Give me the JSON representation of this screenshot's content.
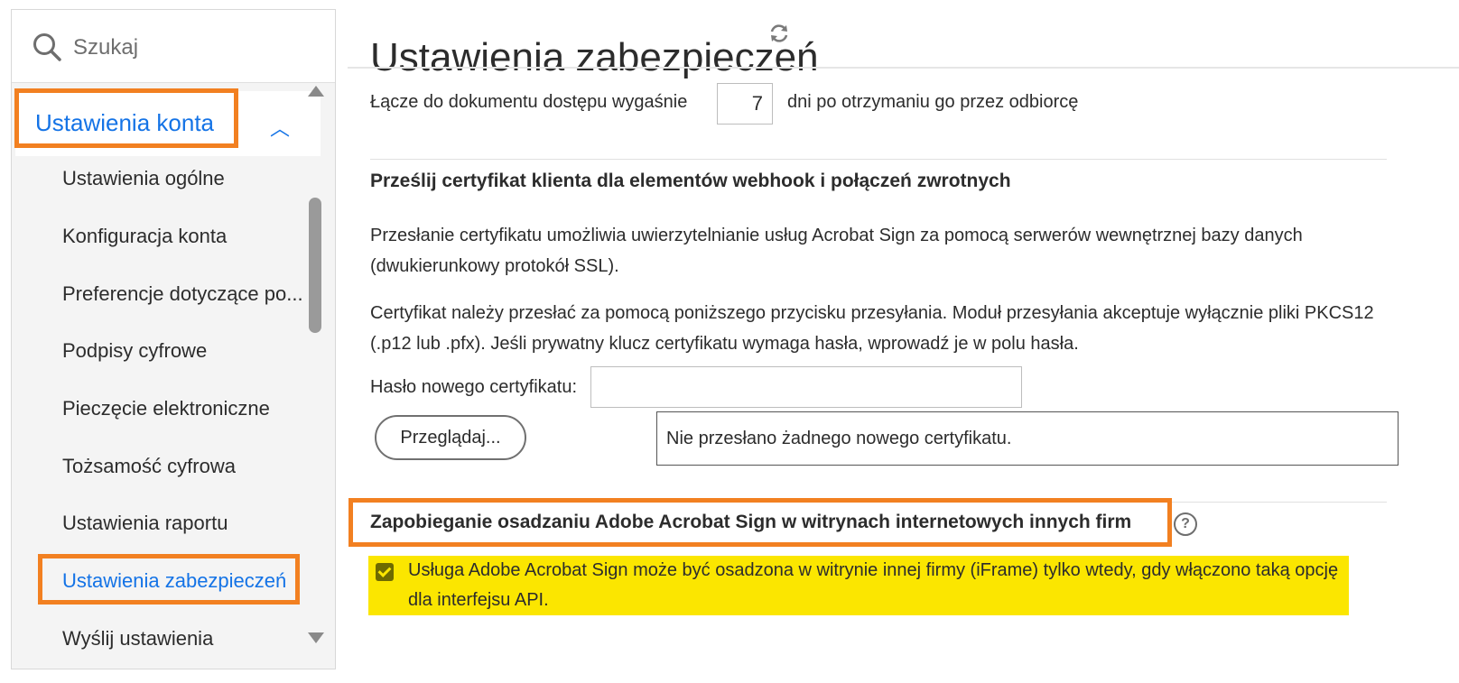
{
  "search": {
    "placeholder": "Szukaj"
  },
  "sidebar": {
    "section_title": "Ustawienia konta",
    "items": [
      {
        "label": "Ustawienia ogólne"
      },
      {
        "label": "Konfiguracja konta"
      },
      {
        "label": "Preferencje dotyczące po..."
      },
      {
        "label": "Podpisy cyfrowe"
      },
      {
        "label": "Pieczęcie elektroniczne"
      },
      {
        "label": "Tożsamość cyfrowa"
      },
      {
        "label": "Ustawienia raportu"
      },
      {
        "label": "Ustawienia zabezpieczeń",
        "active": true
      },
      {
        "label": "Wyślij ustawienia"
      }
    ]
  },
  "main": {
    "title": "Ustawienia zabezpieczeń",
    "expiry": {
      "prefix": "Łącze do dokumentu dostępu wygaśnie",
      "days": "7",
      "suffix": "dni po otrzymaniu go przez odbiorcę"
    },
    "cert": {
      "heading": "Prześlij certyfikat klienta dla elementów webhook i połączeń zwrotnych",
      "para1": "Przesłanie certyfikatu umożliwia uwierzytelnianie usług Acrobat Sign za pomocą serwerów wewnętrznej bazy danych (dwukierunkowy protokół SSL).",
      "para2": "Certyfikat należy przesłać za pomocą poniższego przycisku przesyłania. Moduł przesyłania akceptuje wyłącznie pliki PKCS12 (.p12 lub .pfx). Jeśli prywatny klucz certyfikatu wymaga hasła, wprowadź je w polu hasła.",
      "password_label": "Hasło nowego certyfikatu:",
      "password_value": "",
      "browse_label": "Przeglądaj...",
      "status": "Nie przesłano żadnego nowego certyfikatu."
    },
    "embed": {
      "heading": "Zapobieganie osadzaniu Adobe Acrobat Sign w witrynach internetowych innych firm",
      "help": "?",
      "checkbox_checked": true,
      "checkbox_label": "Usługa Adobe Acrobat Sign może być osadzona w witrynie innej firmy (iFrame) tylko wtedy, gdy włączono taką opcję dla interfejsu API."
    }
  },
  "colors": {
    "accent": "#1473e6",
    "highlight_box": "#f28021",
    "highlight_fill": "#fbe600"
  },
  "icons": [
    "search-icon",
    "chevron-up-icon",
    "refresh-icon",
    "help-icon",
    "checkbox-checked-icon"
  ]
}
